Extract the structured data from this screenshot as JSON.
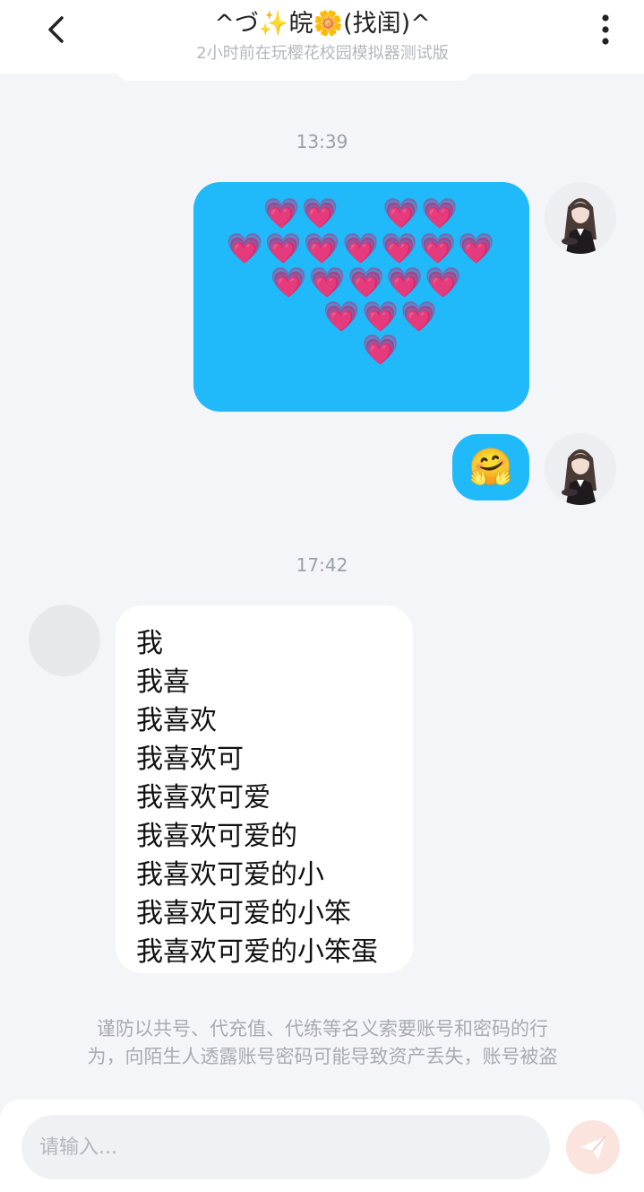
{
  "header": {
    "title": "^づ✨皖🌼(找闺)^",
    "subtitle": "2小时前在玩樱花校园模拟器测试版",
    "back_icon": "chevron-left-icon",
    "more_icon": "vertical-dots-icon"
  },
  "messages": {
    "timestamp_1": "13:39",
    "heart_rows": [
      "💗💗　 💗💗",
      "💗💗💗💗💗💗💗",
      "💗💗💗💗💗",
      "💗💗💗",
      "💗"
    ],
    "emoji": "🤗",
    "timestamp_2": "17:42",
    "lines": [
      "我",
      "我喜",
      "我喜欢",
      "我喜欢可",
      "我喜欢可爱",
      "我喜欢可爱的",
      "我喜欢可爱的小",
      "我喜欢可爱的小笨",
      "我喜欢可爱的小笨蛋"
    ]
  },
  "warning": {
    "line_1": "谨防以共号、代充值、代练等名义索要账号和密码的行",
    "line_2": "为，向陌生人透露账号密码可能导致资产丢失，账号被盗"
  },
  "input": {
    "placeholder": "请输入...",
    "send_icon": "paper-plane-icon"
  },
  "colors": {
    "outgoing_bubble": "#20b9f9",
    "incoming_bubble": "#ffffff",
    "background": "#f3f5f9",
    "send_button": "#fbe3de"
  }
}
